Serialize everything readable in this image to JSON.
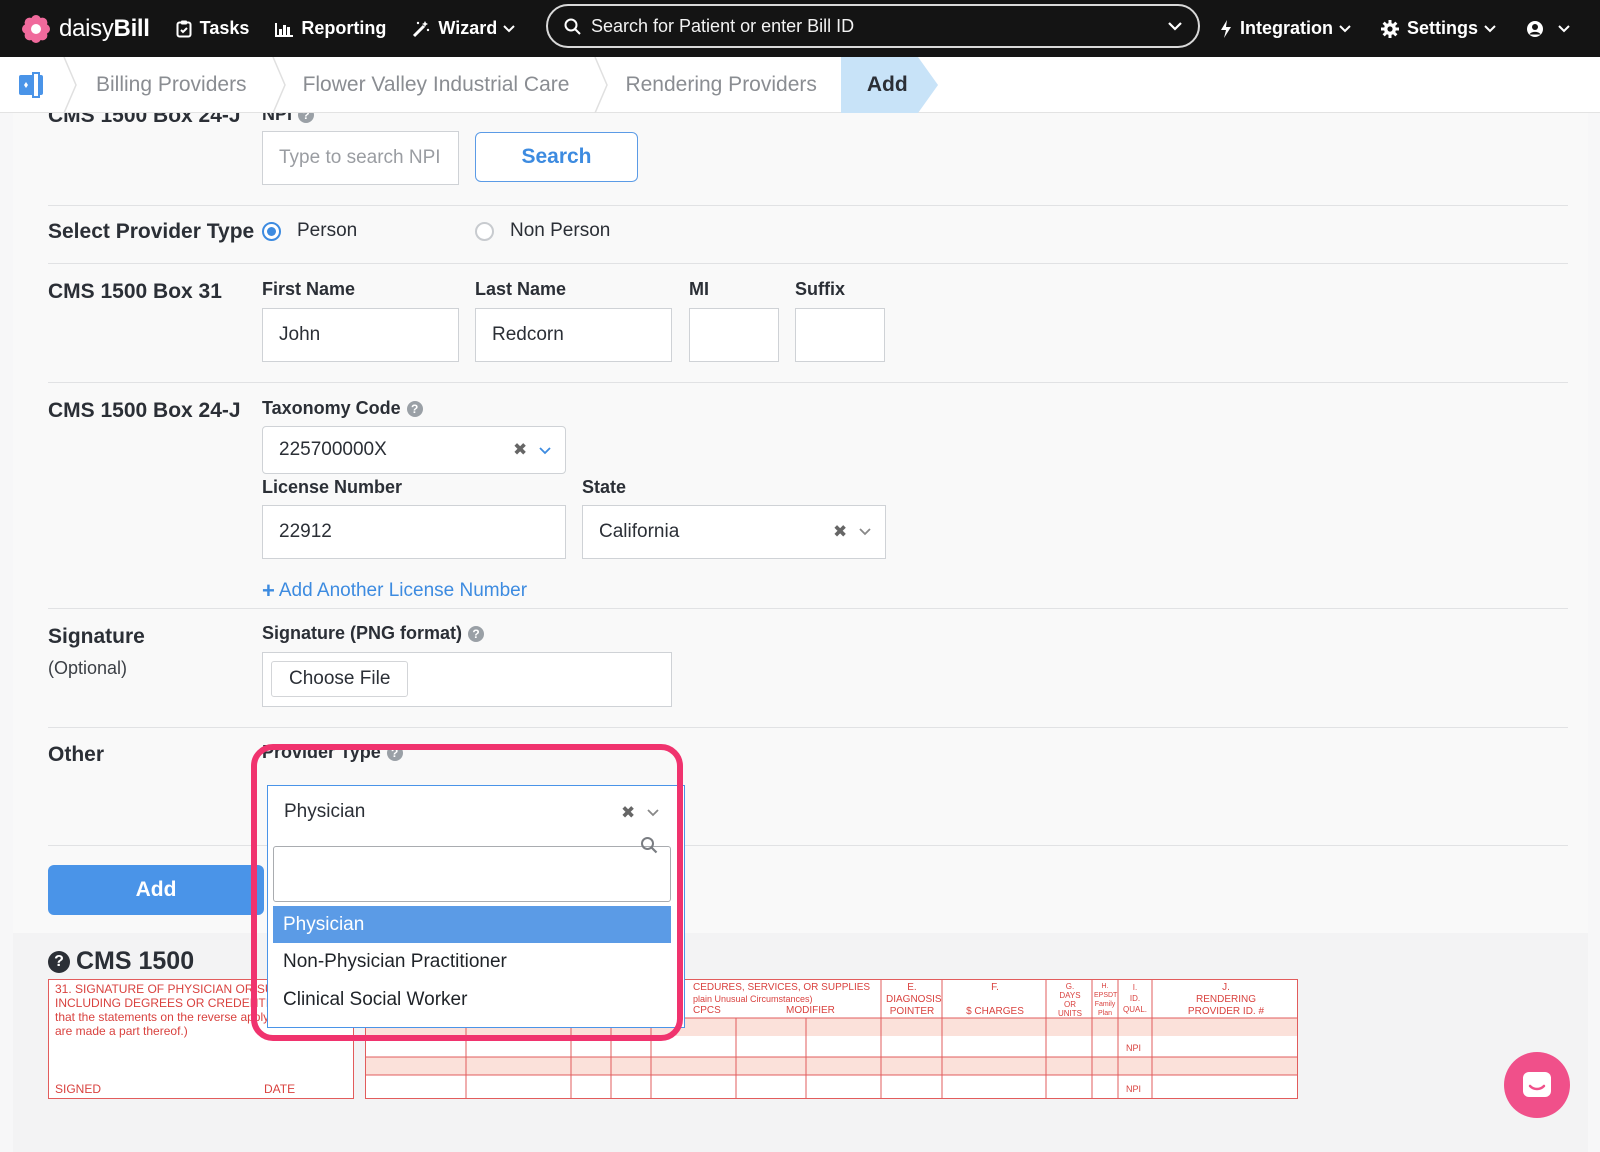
{
  "nav": {
    "brand_prefix": "daisy",
    "brand_suffix": "Bill",
    "tasks": "Tasks",
    "reporting": "Reporting",
    "wizard": "Wizard",
    "search_placeholder": "Search for Patient or enter Bill ID",
    "integration": "Integration",
    "settings": "Settings"
  },
  "breadcrumb": {
    "items": [
      "Billing Providers",
      "Flower Valley Industrial Care",
      "Rendering Providers"
    ],
    "active": "Add"
  },
  "form": {
    "npi_section": "CMS 1500 Box 24-J",
    "npi_label": "NPI",
    "npi_placeholder": "Type to search NPI",
    "search_button": "Search",
    "provider_type_section": "Select Provider Type",
    "radio_person": "Person",
    "radio_non_person": "Non Person",
    "box31_section": "CMS 1500 Box 31",
    "first_name_label": "First Name",
    "first_name": "John",
    "last_name_label": "Last Name",
    "last_name": "Redcorn",
    "mi_label": "MI",
    "mi": "",
    "suffix_label": "Suffix",
    "suffix": "",
    "box24j_section": "CMS 1500 Box 24-J",
    "taxonomy_label": "Taxonomy Code",
    "taxonomy": "225700000X",
    "license_label": "License Number",
    "license": "22912",
    "state_label": "State",
    "state": "California",
    "add_license_link": "Add Another License Number",
    "signature_section": "Signature",
    "signature_optional": "(Optional)",
    "signature_label": "Signature (PNG format)",
    "choose_file": "Choose File",
    "other_section": "Other",
    "provider_type_label": "Provider Type",
    "provider_type_value": "Physician",
    "add_button": "Add"
  },
  "dropdown": {
    "search_value": "",
    "options": [
      "Physician",
      "Non-Physician Practitioner",
      "Clinical Social Worker"
    ],
    "selected_index": 0
  },
  "cms": {
    "title": "CMS 1500",
    "box31_text": "31. SIGNATURE OF PHYSICIAN OR SUPPLIER INCLUDING DEGREES OR CREDENTIALS (I certify that the statements on the reverse apply to this bill and are made a part thereof.)",
    "signed": "SIGNED",
    "date": "DATE",
    "col_d_a": "CEDURES, SERVICES, OR SUPPLIES",
    "col_d_b": "plain Unusual Circumstances)",
    "col_d_c": "CPCS",
    "col_modifier": "MODIFIER",
    "col_e_letter": "E.",
    "col_e_a": "DIAGNOSIS",
    "col_e_b": "POINTER",
    "col_f_letter": "F.",
    "col_f": "$ CHARGES",
    "col_g_letter": "G.",
    "col_g_a": "DAYS",
    "col_g_b": "OR",
    "col_g_c": "UNITS",
    "col_h_letter": "H.",
    "col_h_a": "EPSDT",
    "col_h_b": "Family",
    "col_h_c": "Plan",
    "col_i_letter": "I.",
    "col_i_a": "ID.",
    "col_i_b": "QUAL.",
    "col_j_letter": "J.",
    "col_j_a": "RENDERING",
    "col_j_b": "PROVIDER ID. #",
    "npi_1": "NPI",
    "npi_2": "NPI"
  },
  "colors": {
    "nav_bg": "#141414",
    "accent": "#4a94e8",
    "highlight": "#f0336e",
    "form_red": "#e25c5c",
    "chat": "#f0508a"
  }
}
